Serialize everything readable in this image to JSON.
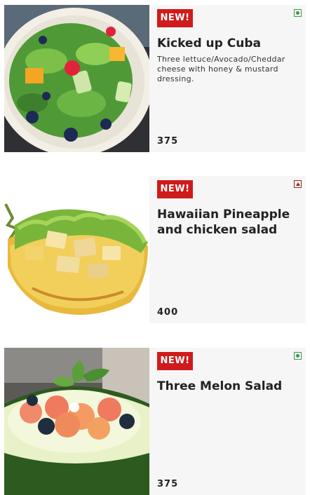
{
  "menu": {
    "items": [
      {
        "badge": "NEW!",
        "name": "Kicked up Cuba",
        "description": "Three lettuce/Avocado/Cheddar cheese with honey & mustard dressing.",
        "price": "375",
        "diet": "veg",
        "image": "green salad bowl"
      },
      {
        "badge": "NEW!",
        "name": "Hawaiian Pineapple and chicken salad",
        "description": "",
        "price": "400",
        "diet": "non-veg",
        "image": "chicken salad in pineapple half"
      },
      {
        "badge": "NEW!",
        "name": "Three Melon Salad",
        "description": "",
        "price": "375",
        "diet": "veg",
        "image": "melon salad in hollowed melon"
      }
    ]
  },
  "colors": {
    "badge": "#cf1b1b",
    "veg": "#3e9a4d",
    "non_veg": "#8a2b1a",
    "card_background": "#f6f6f6"
  }
}
